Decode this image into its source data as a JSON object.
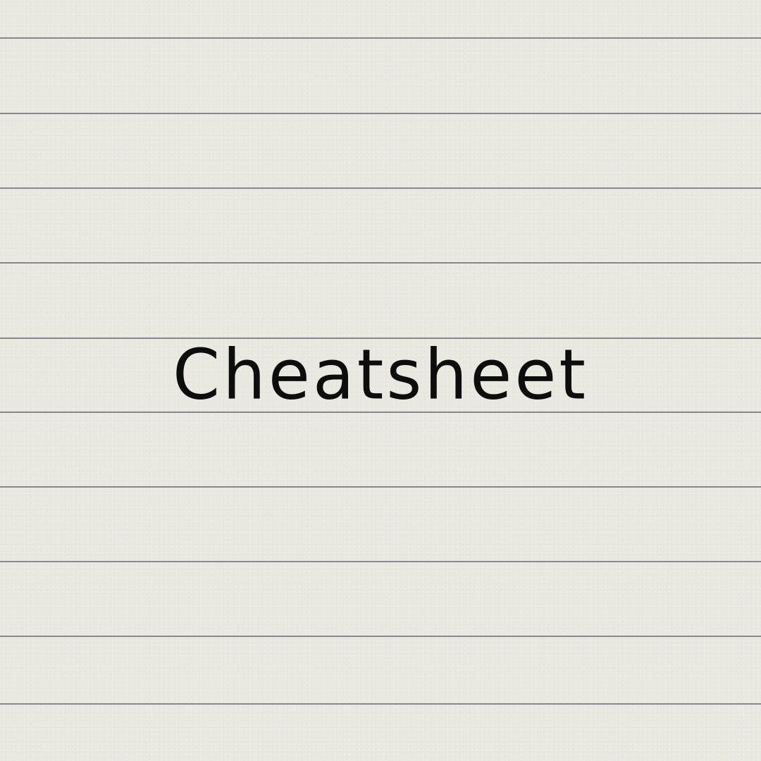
{
  "note": {
    "title": "Cheatsheet"
  },
  "colors": {
    "paper": "#e9e9e0",
    "rule_line": "#77777a",
    "ink": "#0d0d0d"
  }
}
